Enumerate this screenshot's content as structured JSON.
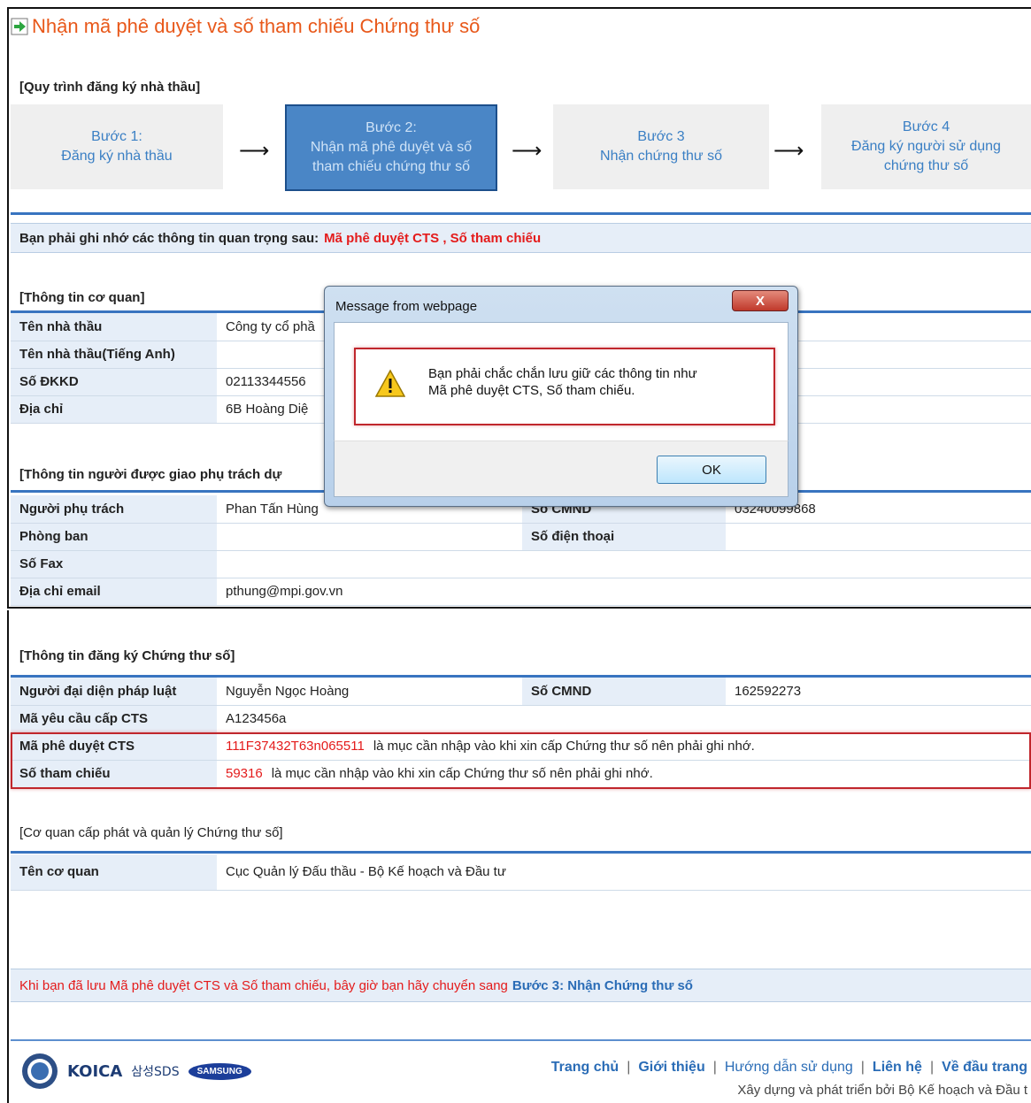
{
  "page": {
    "title": "Nhận mã phê duyệt và số tham chiếu Chứng thư số"
  },
  "process": {
    "heading": "[Quy trình đăng ký nhà thầu]",
    "steps": [
      {
        "line1": "Bước 1:",
        "line2": "Đăng ký nhà thầu",
        "line3": ""
      },
      {
        "line1": "Bước 2:",
        "line2": "Nhận mã phê duyệt và số",
        "line3": "tham chiếu chứng thư số"
      },
      {
        "line1": "Bước 3",
        "line2": "Nhận chứng thư số",
        "line3": ""
      },
      {
        "line1": "Bước 4",
        "line2": "Đăng ký người sử dụng",
        "line3": "chứng thư số"
      }
    ],
    "arrow": "⟶"
  },
  "notice": {
    "text": "Bạn phải ghi nhớ các thông tin quan trọng sau:",
    "highlight": "Mã phê duyệt CTS , Số tham chiếu"
  },
  "org_info": {
    "heading": "[Thông tin cơ quan]",
    "rows": [
      {
        "label": "Tên nhà thầu",
        "value": "Công ty cổ phầ"
      },
      {
        "label": "Tên nhà thầu(Tiếng Anh)",
        "value": ""
      },
      {
        "label": "Số ĐKKD",
        "value": "02113344556"
      },
      {
        "label": "Địa chỉ",
        "value": "6B Hoàng Diệ"
      }
    ]
  },
  "person_info": {
    "heading": "[Thông tin người được giao phụ trách dự",
    "rows": [
      {
        "label": "Người phụ trách",
        "value": "Phan Tấn Hùng",
        "label2": "Số CMND",
        "value2": "03240099868"
      },
      {
        "label": "Phòng ban",
        "value": "",
        "label2": "Số điện thoại",
        "value2": ""
      },
      {
        "label": "Số Fax",
        "value": "",
        "label2": "",
        "value2": ""
      },
      {
        "label": "Địa chỉ email",
        "value": "pthung@mpi.gov.vn",
        "label2": "",
        "value2": ""
      }
    ]
  },
  "cert_info": {
    "heading": "[Thông tin đăng ký Chứng thư số]",
    "rep_label": "Người đại diện pháp luật",
    "rep_value": "Nguyễn Ngọc Hoàng",
    "cmnd_label": "Số CMND",
    "cmnd_value": "162592273",
    "req_label": "Mã yêu cầu cấp CTS",
    "req_value": "A123456a",
    "approval_label": "Mã phê duyệt CTS",
    "approval_value": "111F37432T63n065511",
    "approval_hint": "là mục cần nhập vào khi xin cấp Chứng thư số nên phải ghi nhớ.",
    "ref_label": "Số tham chiếu",
    "ref_value": "59316",
    "ref_hint": "là mục cần nhập vào khi xin cấp Chứng thư số nên phải ghi nhớ."
  },
  "issuer": {
    "heading": "[Cơ quan cấp phát và quản lý Chứng thư số]",
    "label": "Tên cơ quan",
    "value": "Cục Quản lý Đấu thầu - Bộ Kế hoạch và Đầu tư"
  },
  "final_note": {
    "text": "Khi bạn đã lưu Mã phê duyệt CTS và Số tham chiếu, bây giờ bạn hãy chuyển sang",
    "link": "Bước 3: Nhận Chứng thư số"
  },
  "footer": {
    "links": [
      "Trang chủ",
      "Giới thiệu",
      "Hướng dẫn sử dụng",
      "Liên hệ",
      "Về đầu trang"
    ],
    "sep": "|",
    "copyright": "Xây dựng và phát triển bởi Bộ Kế hoạch và Đầu t",
    "logo_koica": "KOICA",
    "logo_sds": "삼성SDS",
    "logo_samsung": "SAMSUNG"
  },
  "dialog": {
    "title": "Message from webpage",
    "close": "X",
    "line1": "Bạn phải chắc chắn lưu giữ các thông tin như",
    "line2": "Mã phê duyệt CTS, Số tham chiếu.",
    "ok": "OK"
  },
  "colors": {
    "accent": "#e8581a",
    "link": "#2a6cb6",
    "warning_red": "#e41b1b",
    "label_bg": "#e6eef8"
  }
}
